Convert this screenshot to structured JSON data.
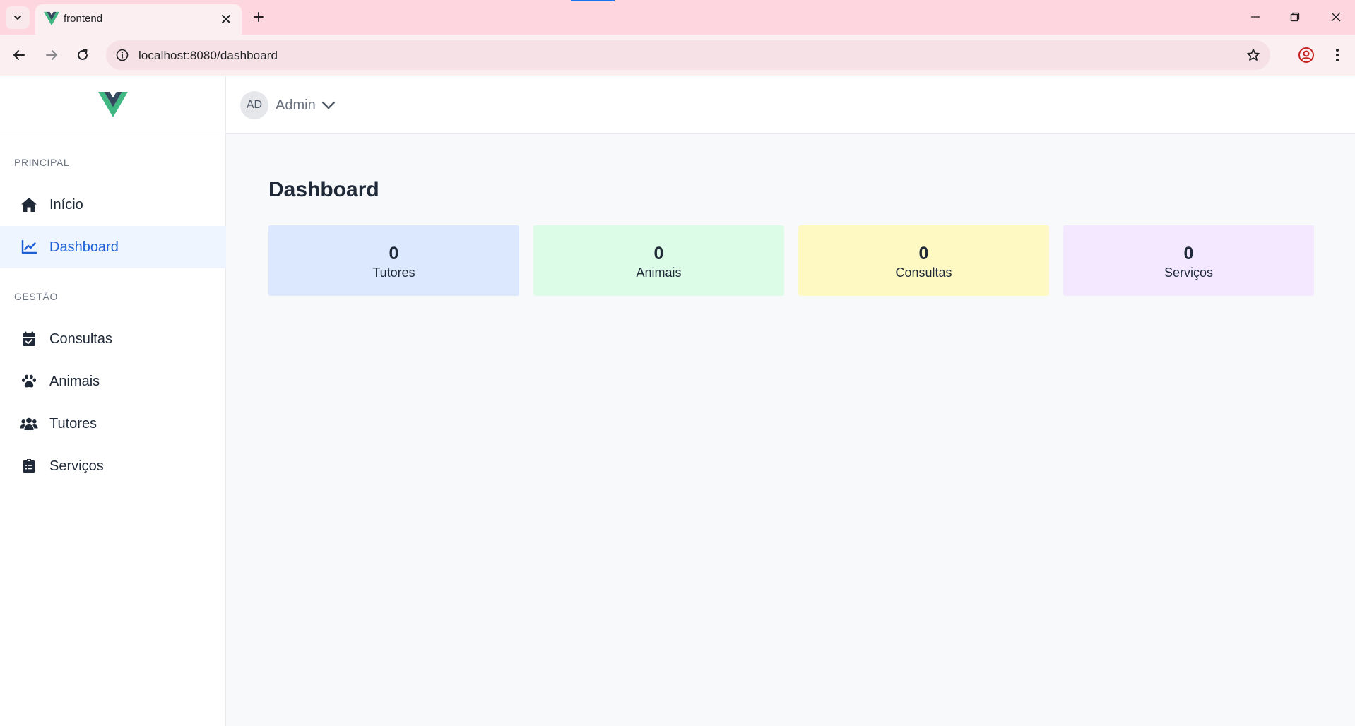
{
  "browser": {
    "tab_title": "frontend",
    "url": "localhost:8080/dashboard"
  },
  "sidebar": {
    "sections": [
      {
        "title": "PRINCIPAL",
        "items": [
          {
            "label": "Início",
            "icon": "home-icon",
            "active": false
          },
          {
            "label": "Dashboard",
            "icon": "chart-line-icon",
            "active": true
          }
        ]
      },
      {
        "title": "GESTÃO",
        "items": [
          {
            "label": "Consultas",
            "icon": "calendar-check-icon",
            "active": false
          },
          {
            "label": "Animais",
            "icon": "paw-icon",
            "active": false
          },
          {
            "label": "Tutores",
            "icon": "users-icon",
            "active": false
          },
          {
            "label": "Serviços",
            "icon": "clipboard-list-icon",
            "active": false
          }
        ]
      }
    ]
  },
  "header": {
    "avatar_initials": "AD",
    "user_name": "Admin"
  },
  "main": {
    "title": "Dashboard",
    "stats": [
      {
        "value": "0",
        "label": "Tutores",
        "color": "#dbe8fe"
      },
      {
        "value": "0",
        "label": "Animais",
        "color": "#dcfce7"
      },
      {
        "value": "0",
        "label": "Consultas",
        "color": "#fef9c3"
      },
      {
        "value": "0",
        "label": "Serviços",
        "color": "#f3e8ff"
      }
    ]
  },
  "colors": {
    "accent": "#1d5fd6",
    "logo_green": "#41b883",
    "logo_dark": "#34495e"
  }
}
